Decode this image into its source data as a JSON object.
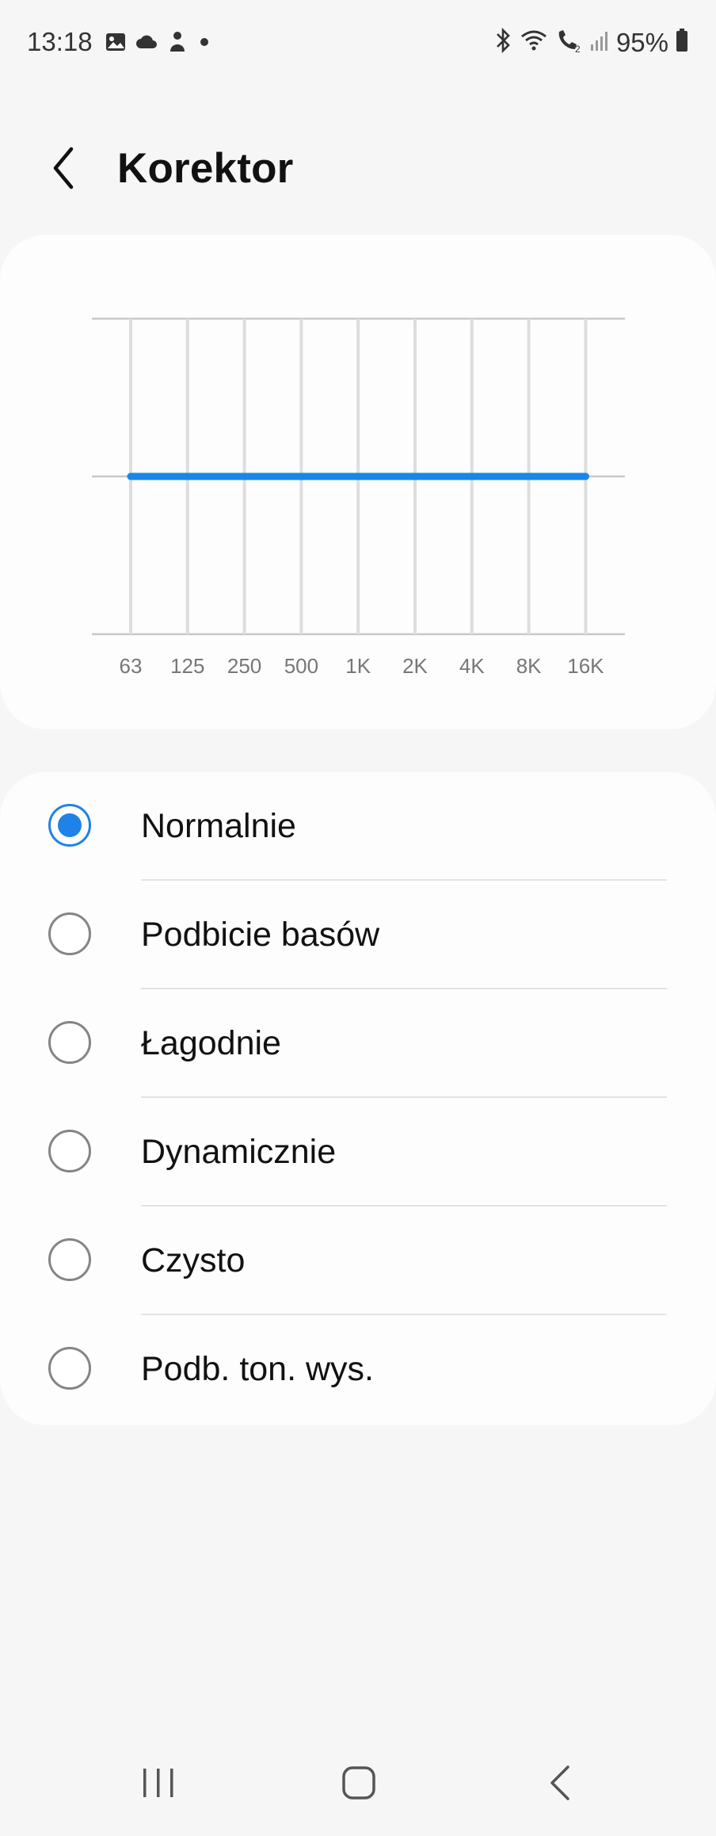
{
  "status_bar": {
    "time": "13:18",
    "battery": "95%",
    "left_icons": [
      "gallery-icon",
      "cloud-icon",
      "person-icon",
      "dot-icon"
    ],
    "right_icons": [
      "bluetooth-icon",
      "wifi-icon",
      "wifi-calling-icon",
      "signal-icon",
      "battery-icon"
    ]
  },
  "header": {
    "title": "Korektor",
    "back_icon": "chevron-left-icon"
  },
  "chart_data": {
    "type": "line",
    "categories": [
      "63",
      "125",
      "250",
      "500",
      "1K",
      "2K",
      "4K",
      "8K",
      "16K"
    ],
    "values": [
      0,
      0,
      0,
      0,
      0,
      0,
      0,
      0,
      0
    ],
    "ylim": [
      -1,
      1
    ],
    "line_color": "#1a86e8"
  },
  "presets": [
    {
      "label": "Normalnie",
      "selected": true
    },
    {
      "label": "Podbicie basów",
      "selected": false
    },
    {
      "label": "Łagodnie",
      "selected": false
    },
    {
      "label": "Dynamicznie",
      "selected": false
    },
    {
      "label": "Czysto",
      "selected": false
    },
    {
      "label": "Podb. ton. wys.",
      "selected": false
    }
  ],
  "nav_bar": {
    "recents_icon": "recents-icon",
    "home_icon": "home-icon",
    "back_icon": "back-icon"
  },
  "colors": {
    "accent": "#1f82e6",
    "background": "#f6f6f6",
    "card": "#fdfdfd"
  }
}
